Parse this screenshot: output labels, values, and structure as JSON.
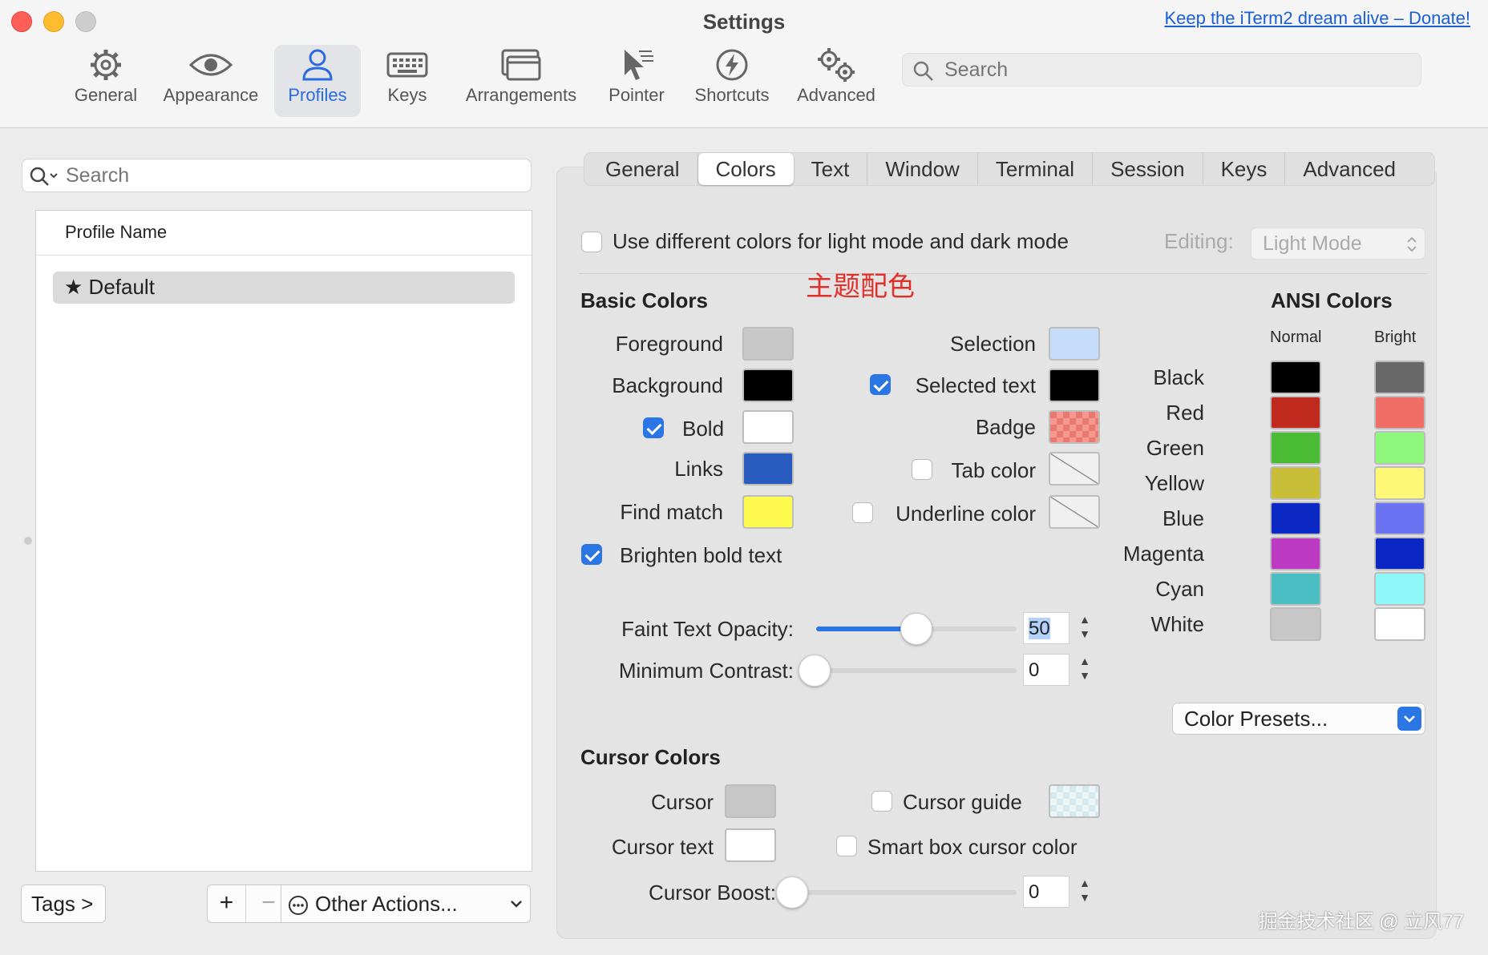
{
  "window": {
    "title": "Settings",
    "donate_link": "Keep the iTerm2 dream alive – Donate!"
  },
  "toolbar": {
    "items": [
      {
        "label": "General",
        "icon": "gear-icon"
      },
      {
        "label": "Appearance",
        "icon": "eye-icon"
      },
      {
        "label": "Profiles",
        "icon": "person-icon",
        "selected": true
      },
      {
        "label": "Keys",
        "icon": "keyboard-icon"
      },
      {
        "label": "Arrangements",
        "icon": "windows-icon"
      },
      {
        "label": "Pointer",
        "icon": "pointer-icon"
      },
      {
        "label": "Shortcuts",
        "icon": "bolt-icon"
      },
      {
        "label": "Advanced",
        "icon": "gears-icon"
      }
    ],
    "search_placeholder": "Search"
  },
  "profiles": {
    "search_placeholder": "Search",
    "column_header": "Profile Name",
    "rows": [
      "Default"
    ],
    "tags_button": "Tags >",
    "add_button": "+",
    "remove_button": "−",
    "other_actions": "Other Actions..."
  },
  "tabs": [
    "General",
    "Colors",
    "Text",
    "Window",
    "Terminal",
    "Session",
    "Keys",
    "Advanced"
  ],
  "selected_tab": "Colors",
  "colors": {
    "light_dark_label": "Use different colors for light mode and dark mode",
    "editing_label": "Editing:",
    "editing_value": "Light Mode",
    "annotation": "主题配色",
    "basic_header": "Basic Colors",
    "foreground": "Foreground",
    "background": "Background",
    "bold": "Bold",
    "links": "Links",
    "find_match": "Find match",
    "brighten_bold": "Brighten bold text",
    "selection": "Selection",
    "selected_text": "Selected text",
    "badge": "Badge",
    "tab_color": "Tab color",
    "underline_color": "Underline color",
    "faint_opacity_label": "Faint Text Opacity:",
    "faint_opacity_value": "50",
    "faint_opacity_level": 0.5,
    "min_contrast_label": "Minimum Contrast:",
    "min_contrast_value": "0",
    "min_contrast_level": 0,
    "cursor_header": "Cursor Colors",
    "cursor": "Cursor",
    "cursor_text": "Cursor text",
    "cursor_guide": "Cursor guide",
    "smart_box": "Smart box cursor color",
    "cursor_boost_label": "Cursor Boost:",
    "cursor_boost_value": "0",
    "cursor_boost_level": 0,
    "swatches": {
      "foreground": "#c7c7c7",
      "background": "#000000",
      "bold": "#ffffff",
      "links": "#2a5cbf",
      "find_match": "#fdf94f",
      "selection": "#c5dcfb",
      "selected_text": "#000000",
      "badge": "#f0897f",
      "cursor": "#c7c7c7",
      "cursor_text": "#ffffff",
      "cursor_guide": "#d9ecf1"
    }
  },
  "ansi": {
    "header": "ANSI Colors",
    "normal_label": "Normal",
    "bright_label": "Bright",
    "rows": [
      {
        "name": "Black",
        "normal": "#000000",
        "bright": "#686868"
      },
      {
        "name": "Red",
        "normal": "#c02a1f",
        "bright": "#f16e67"
      },
      {
        "name": "Green",
        "normal": "#4abb35",
        "bright": "#8df77b"
      },
      {
        "name": "Yellow",
        "normal": "#c8bd36",
        "bright": "#fef876"
      },
      {
        "name": "Blue",
        "normal": "#0b28c3",
        "bright": "#6a73f1"
      },
      {
        "name": "Magenta",
        "normal": "#bd3bc4",
        "bright": "#0a26c4"
      },
      {
        "name": "Cyan",
        "normal": "#4bbec4",
        "bright": "#8ef7f8"
      },
      {
        "name": "White",
        "normal": "#c7c7c7",
        "bright": "#ffffff"
      }
    ],
    "presets_label": "Color Presets..."
  },
  "watermark": "掘金技术社区 @ 立风77"
}
